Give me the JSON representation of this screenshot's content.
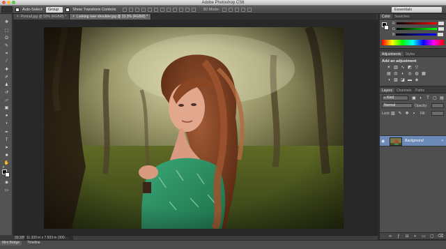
{
  "window": {
    "title": "Adobe Photoshop CS6"
  },
  "options_bar": {
    "auto_select_label": "Auto-Select:",
    "auto_select_value": "Group",
    "transform_controls_label": "Show Transform Controls",
    "mode_3d_label": "3D Mode:",
    "workspace_value": "Essentials"
  },
  "documents": {
    "tabs": [
      {
        "label": "Portrait.jpg @ 50% (RGB/8) *",
        "close": "×"
      },
      {
        "label": "Looking over shoulder.jpg @ 33.3% (RGB/8) *",
        "close": "×"
      }
    ]
  },
  "status_bar": {
    "zoom": "33.33%",
    "doc_info": "11.333 in x 7.933 in (300..."
  },
  "bottom_tabs": {
    "mini_bridge": "Mini Bridge",
    "timeline": "Timeline"
  },
  "panels": {
    "color": {
      "tabs": [
        "Color",
        "Swatches"
      ],
      "channels": [
        "R",
        "G",
        "B"
      ]
    },
    "adjustments": {
      "tabs": [
        "Adjustments",
        "Styles"
      ],
      "title": "Add an adjustment"
    },
    "layers": {
      "tabs": [
        "Layers",
        "Channels",
        "Paths"
      ],
      "kind_label": "Kind",
      "blend_mode": "Normal",
      "opacity_label": "Opacity:",
      "lock_label": "Lock:",
      "fill_label": "Fill:",
      "layer_name": "Background"
    }
  },
  "icons": {
    "close": "×",
    "eye": "◉",
    "lock": "🔒"
  },
  "colors": {
    "selected_layer": "#6c8ab8",
    "active_tab": "#666666",
    "canvas_bg": "#282828"
  }
}
